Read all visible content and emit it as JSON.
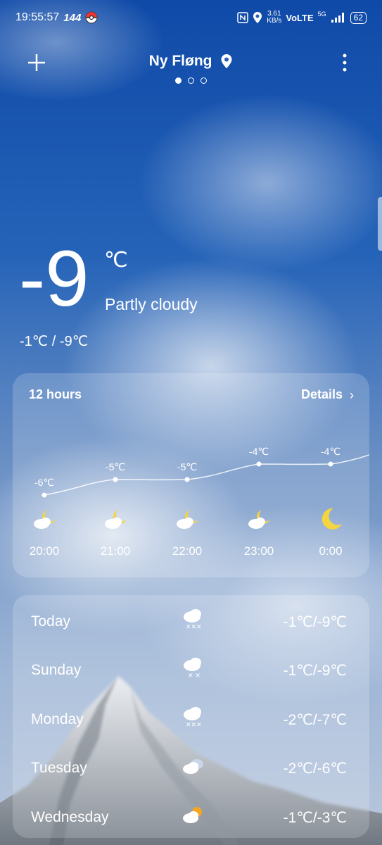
{
  "status_bar": {
    "time": "19:55:57",
    "refresh_rate": "144",
    "data_speed_value": "3.61",
    "data_speed_unit": "KB/s",
    "network": "VoLTE",
    "network_gen": "5G",
    "battery": "62"
  },
  "header": {
    "location": "Ny Fløng",
    "page_count": 3,
    "active_page": 0
  },
  "current": {
    "temperature": "-9",
    "unit": "℃",
    "condition": "Partly cloudy",
    "range": "-1℃ / -9℃"
  },
  "hourly": {
    "title": "12 hours",
    "details_label": "Details",
    "items": [
      {
        "time": "20:00",
        "temp": "-6℃",
        "icon": "partly-cloudy-night-icon"
      },
      {
        "time": "21:00",
        "temp": "-5℃",
        "icon": "partly-cloudy-night-icon"
      },
      {
        "time": "22:00",
        "temp": "-5℃",
        "icon": "partly-cloudy-night-icon"
      },
      {
        "time": "23:00",
        "temp": "-4℃",
        "icon": "partly-cloudy-night-icon"
      },
      {
        "time": "0:00",
        "temp": "-4℃",
        "icon": "moon-icon"
      }
    ]
  },
  "daily": [
    {
      "day": "Today",
      "range": "-1℃/-9℃",
      "icon": "snow-cloud-icon"
    },
    {
      "day": "Sunday",
      "range": "-1℃/-9℃",
      "icon": "snow-cloud-icon"
    },
    {
      "day": "Monday",
      "range": "-2℃/-7℃",
      "icon": "snow-cloud-icon"
    },
    {
      "day": "Tuesday",
      "range": "-2℃/-6℃",
      "icon": "cloudy-icon"
    },
    {
      "day": "Wednesday",
      "range": "-1℃/-3℃",
      "icon": "partly-sunny-icon"
    }
  ],
  "colors": {
    "sky_top": "#0f4aa8",
    "moon": "#f5d442",
    "sun": "#f5a623"
  }
}
